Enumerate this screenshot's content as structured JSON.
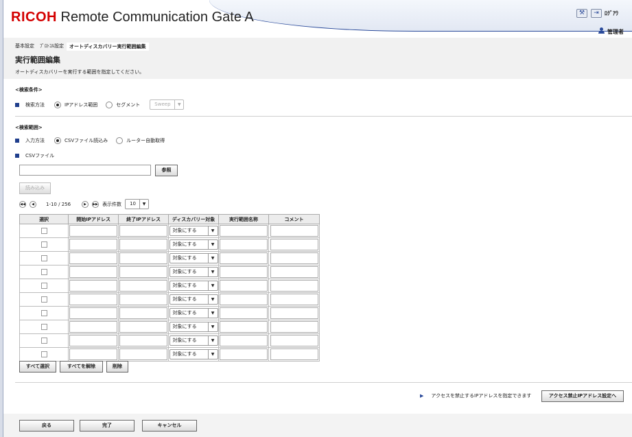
{
  "header": {
    "brand": "RICOH",
    "product": "Remote Communication Gate A",
    "logout_label": "ﾛｸﾞｱｳ",
    "user_label": "管理者"
  },
  "breadcrumb": [
    "基本設定",
    "ﾌﾟﾛﾄｺﾙ設定",
    "オートディスカバリー実行範囲編集"
  ],
  "page": {
    "title": "実行範囲編集",
    "description": "オートディスカバリーを実行する範囲を指定してください。"
  },
  "search_condition": {
    "title": "<検索条件>",
    "method_label": "検索方法",
    "options": [
      "IPアドレス範囲",
      "セグメント"
    ],
    "selected": 0,
    "sweep_value": "Sweep"
  },
  "search_range": {
    "title": "<検索範囲>",
    "input_label": "入力方法",
    "options": [
      "CSVファイル読込み",
      "ルーター自動取得"
    ],
    "selected": 0,
    "csv_label": "CSVファイル",
    "csv_value": "",
    "browse_label": "参照",
    "load_label": "読み込み"
  },
  "pager": {
    "range_text": "1-10 / 256",
    "per_page_label": "表示件数",
    "per_page_value": "10"
  },
  "table": {
    "columns": [
      "選択",
      "開始IPアドレス",
      "終了IPアドレス",
      "ディスカバリー対象",
      "実行範囲名称",
      "コメント"
    ],
    "rows": [
      {
        "target": "対象にする"
      },
      {
        "target": "対象にする"
      },
      {
        "target": "対象にする"
      },
      {
        "target": "対象にする"
      },
      {
        "target": "対象にする"
      },
      {
        "target": "対象にする"
      },
      {
        "target": "対象にする"
      },
      {
        "target": "対象にする"
      },
      {
        "target": "対象にする"
      },
      {
        "target": "対象にする"
      }
    ]
  },
  "actions": {
    "select_all": "すべて選択",
    "deselect_all": "すべてを解除",
    "delete": "削除"
  },
  "access": {
    "note": "アクセスを禁止するIPアドレスを指定できます",
    "button": "アクセス禁止IPアドレス設定へ"
  },
  "footer": {
    "back": "戻る",
    "done": "完了",
    "cancel": "キャンセル"
  }
}
